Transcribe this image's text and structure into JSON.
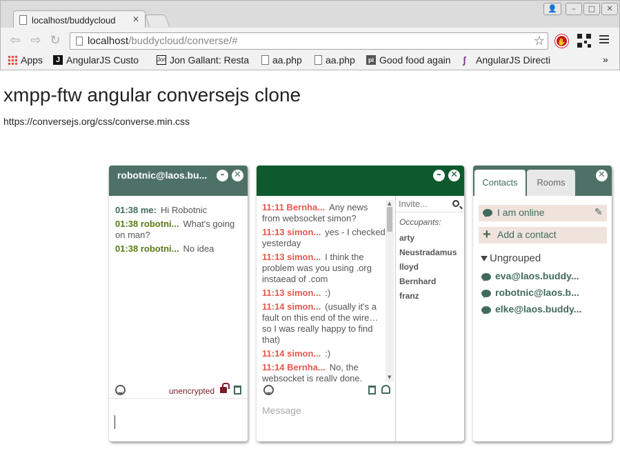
{
  "browser": {
    "tab_title": "localhost/buddycloud",
    "url_host": "localhost",
    "url_path": "/buddycloud/converse/#",
    "bookmarks": [
      "Apps",
      "AngularJS Custo",
      "Jon Gallant: Resta",
      "aa.php",
      "aa.php",
      "Good food again",
      "AngularJS Directi"
    ],
    "bookmark_more": "»"
  },
  "page": {
    "heading": "xmpp-ftw angular conversejs clone",
    "css_link": "https://conversejs.org/css/converse.min.css"
  },
  "chat1": {
    "title": "robotnic@laos.bu...",
    "messages": [
      {
        "time": "01:38 me:",
        "text": "Hi Robotnic"
      },
      {
        "time": "01:38 robotni...",
        "text": "What's going on man?"
      },
      {
        "time": "01:38 robotni...",
        "text": "No idea"
      }
    ],
    "encryption": "unencrypted"
  },
  "room": {
    "messages": [
      {
        "time": "11:11 Bernha...",
        "text": "Any news from websocket simon?"
      },
      {
        "time": "11:13 simon...",
        "text": "yes - I checked yesterday"
      },
      {
        "time": "11:13 simon...",
        "text": "I think the problem was you using .org instaead of .com"
      },
      {
        "time": "11:13 simon...",
        "text": ":)"
      },
      {
        "time": "11:14 simon...",
        "text": "(usually it's a fault on this end of the wire… so I was really happy to find that)"
      },
      {
        "time": "11:14 simon...",
        "text": ":)"
      },
      {
        "time": "11:14 Bernha...",
        "text": "No, the websocket is really done,"
      }
    ],
    "invite_placeholder": "Invite...",
    "occupants_label": "Occupants:",
    "occupants": [
      "arty",
      "Neustradamus",
      "lloyd",
      "Bernhard",
      "franz"
    ],
    "message_placeholder": "Message"
  },
  "controlbox": {
    "tabs": [
      "Contacts",
      "Rooms"
    ],
    "status": "I am online",
    "add_contact": "Add a contact",
    "group": "Ungrouped",
    "contacts": [
      "eva@laos.buddy...",
      "robotnic@laos.b...",
      "elke@laos.buddy..."
    ]
  },
  "colors": {
    "header_green": "#4e7167",
    "room_header": "#0e5a2e",
    "my_time": "#406a5e",
    "their_time": "#5a7a10",
    "room_time": "#e6584f",
    "unencrypted": "#7b1c28"
  }
}
